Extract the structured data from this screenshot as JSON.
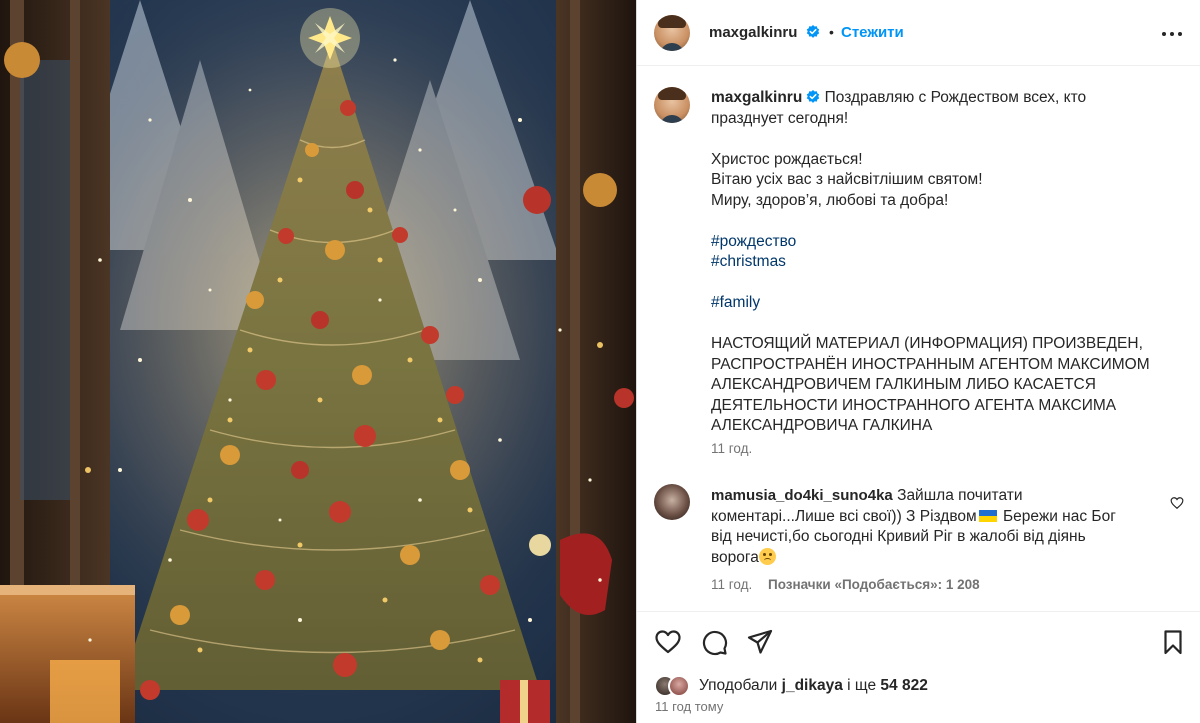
{
  "post": {
    "image_alt": "Christmas tree with golden lights and red ornaments",
    "author": {
      "username": "maxgalkinru",
      "verified": true,
      "follow_label": "Стежити",
      "separator": "•"
    },
    "caption": {
      "lines": [
        "Поздравляю с Рождеством всех, кто",
        "празднует сегодня!",
        "",
        "Христос рождається!",
        "Вітаю усіх вас з найсвітлішим святом!",
        "Миру, здоров’я, любові та добра!",
        "",
        "#рождество",
        "#christmas",
        "",
        "#family",
        "",
        "НАСТОЯЩИЙ МАТЕРИАЛ (ИНФОРМАЦИЯ) ПРОИЗВЕДЕН,",
        "РАСПРОСТРАНЁН ИНОСТРАННЫМ АГЕНТОМ МАКСИМОМ",
        "АЛЕКСАНДРОВИЧЕМ ГАЛКИНЫМ ЛИБО КАСАЕТСЯ",
        "ДЕЯТЕЛЬНОСТИ ИНОСТРАННОГО АГЕНТА МАКСИМА",
        "АЛЕКСАНДРОВИЧА ГАЛКИНА"
      ],
      "time": "11 год."
    },
    "comment": {
      "username": "mamusia_do4ki_suno4ka",
      "text_part1": "Зайшла почитати",
      "text_part2": "коментарі...Лише всі свої)) З Різдвом",
      "text_part3": "Бережи нас Бог",
      "text_part4": "від нечисті,бо сьогодні Кривий Ріг в жалобі від діянь",
      "text_part5": "ворога",
      "time": "11 год.",
      "likes": "Позначки «Подобається»: 1 208"
    },
    "likes": {
      "prefix": "Уподобали",
      "user": "j_dikaya",
      "middle": "і ще",
      "count": "54 822"
    },
    "date": "11 год тому"
  },
  "icons": {
    "more": "more-horizontal-icon",
    "like": "heart-icon",
    "comment": "comment-icon",
    "share": "paper-plane-icon",
    "save": "bookmark-icon",
    "verified": "verified-badge-icon"
  },
  "colors": {
    "accent": "#0095f6",
    "hashtag": "#00376b",
    "verified": "#0095f6",
    "muted": "#737373"
  }
}
